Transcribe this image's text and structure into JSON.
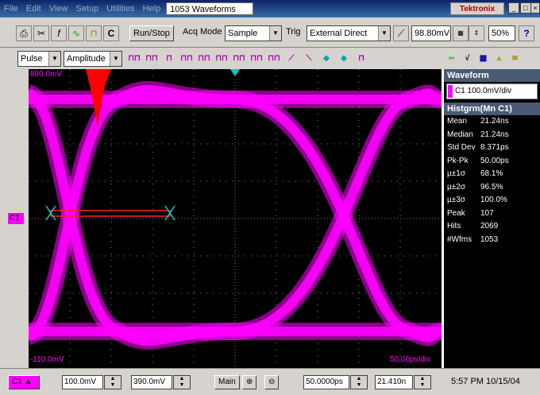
{
  "menu": {
    "items": [
      "File",
      "Edit",
      "View",
      "Setup",
      "Utilities",
      "Help"
    ],
    "title_field": "1053 Waveforms",
    "brand": "Tektronix",
    "window_buttons": [
      "_",
      "□",
      "×"
    ]
  },
  "toolbar": {
    "clear_label": "C",
    "runstop_label": "Run/Stop",
    "acqmode_label": "Acq Mode",
    "acqmode_value": "Sample",
    "trig_label": "Trig",
    "trig_value": "External Direct",
    "trig_level": "98.80mV",
    "zoom_value": "50%",
    "help_icon": "?"
  },
  "meas_bar": {
    "category_value": "Pulse",
    "type_value": "Amplitude"
  },
  "plot": {
    "top_label": "890.0mV",
    "bottom_label": "-110.0mV",
    "time_div": "50.00ps/div",
    "channel_marker": "C1",
    "colors": {
      "trace": "#ff00ff",
      "histogram": "#ff0000",
      "background": "#000000",
      "grid": "#888888"
    }
  },
  "readout": {
    "waveform_header": "Waveform",
    "waveform_value": "C1 100.0mV/div",
    "histogram_header": "Histgrm(Mn C1)",
    "stats": [
      {
        "label": "Mean",
        "value": "21.24ns"
      },
      {
        "label": "Median",
        "value": "21.24ns"
      },
      {
        "label": "Std Dev",
        "value": "8.371ps"
      },
      {
        "label": "Pk-Pk",
        "value": "50.00ps"
      },
      {
        "label": "µ±1σ",
        "value": "68.1%"
      },
      {
        "label": "µ±2σ",
        "value": "96.5%"
      },
      {
        "label": "µ±3σ",
        "value": "100.0%"
      },
      {
        "label": "Peak",
        "value": "107"
      },
      {
        "label": "Hits",
        "value": "2069"
      },
      {
        "label": "#Wfms",
        "value": "1053"
      }
    ]
  },
  "bottom": {
    "channel": "C1",
    "scale": "100.0mV",
    "offset": "390.0mV",
    "main_label": "Main",
    "timebase": "50.0000ps",
    "position": "21.410n",
    "clock": "5:57 PM 10/15/04"
  }
}
